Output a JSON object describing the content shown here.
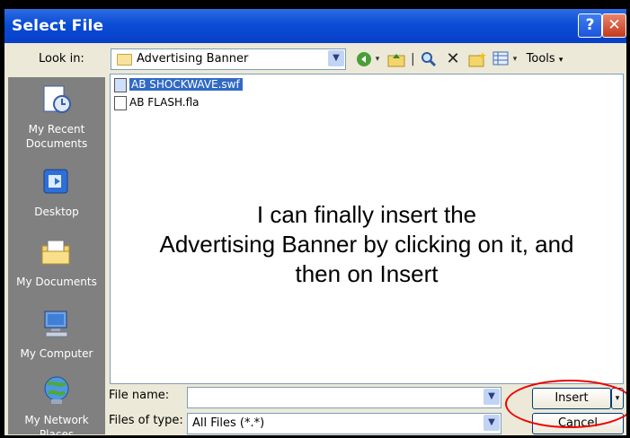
{
  "window": {
    "title": "Select File"
  },
  "lookin": {
    "label": "Look in:",
    "value": "Advertising Banner"
  },
  "toolbar": {
    "tools_label": "Tools"
  },
  "places": [
    {
      "label": "My Recent Documents"
    },
    {
      "label": "Desktop"
    },
    {
      "label": "My Documents"
    },
    {
      "label": "My Computer"
    },
    {
      "label": "My Network Places"
    }
  ],
  "files": [
    {
      "name": "AB SHOCKWAVE.swf",
      "selected": true
    },
    {
      "name": "AB FLASH.fla",
      "selected": false
    }
  ],
  "annotation": {
    "line1": "I can finally insert the",
    "line2": "Advertising Banner by clicking on it, and",
    "line3": "then on Insert"
  },
  "form": {
    "file_name_label": "File name:",
    "file_name_value": "",
    "file_type_label": "Files of type:",
    "file_type_value": "All Files (*.*)"
  },
  "buttons": {
    "insert": "Insert",
    "cancel": "Cancel"
  },
  "colors": {
    "titlebar": "#0a4cd6",
    "places_bg": "#808080",
    "selection": "#316ac5",
    "highlight": "#e00000"
  }
}
